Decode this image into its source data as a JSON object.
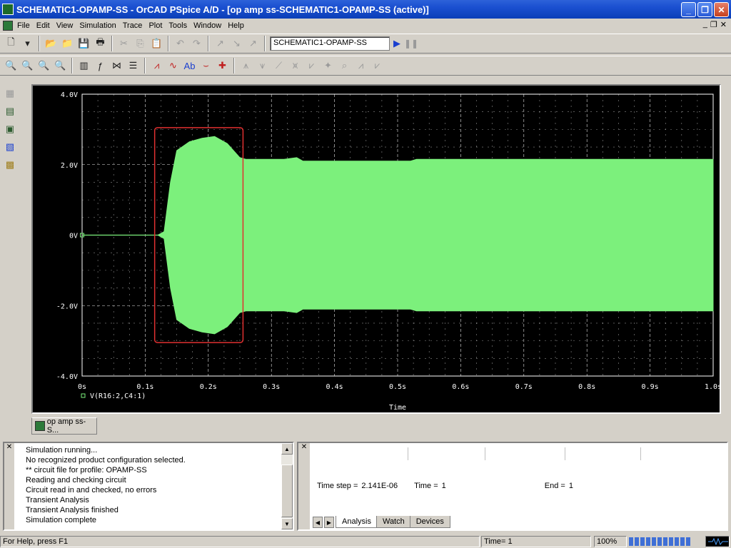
{
  "window": {
    "title": "SCHEMATIC1-OPAMP-SS - OrCAD PSpice A/D  - [op amp ss-SCHEMATIC1-OPAMP-SS (active)]",
    "minimize": "_",
    "maximize": "❐",
    "close": "✕"
  },
  "menu": {
    "items": [
      "File",
      "Edit",
      "View",
      "Simulation",
      "Trace",
      "Plot",
      "Tools",
      "Window",
      "Help"
    ],
    "mdi_minimize": "_",
    "mdi_restore": "❐",
    "mdi_close": "✕"
  },
  "toolbar": {
    "profile": "SCHEMATIC1-OPAMP-SS",
    "run": "▶",
    "pause": "❚❚"
  },
  "plot": {
    "x_label": "Time",
    "legend": "V(R16:2,C4:1)",
    "colors": {
      "background": "#000000",
      "trace": "#7cf07c",
      "grid": "#ffffff",
      "highlight": "#e03030"
    },
    "chart_data": {
      "type": "line",
      "xlabel": "Time",
      "ylabel": "",
      "xlim": [
        0,
        1.0
      ],
      "ylim": [
        -4,
        4
      ],
      "x_ticks": [
        "0s",
        "0.1s",
        "0.2s",
        "0.3s",
        "0.4s",
        "0.5s",
        "0.6s",
        "0.7s",
        "0.8s",
        "0.9s",
        "1.0s"
      ],
      "y_ticks": [
        "4.0V",
        "2.0V",
        "0V",
        "-2.0V",
        "-4.0V"
      ],
      "grid": true,
      "series": [
        {
          "name": "V(R16:2,C4:1)",
          "envelope": {
            "x": [
              0.0,
              0.12,
              0.13,
              0.14,
              0.15,
              0.17,
              0.19,
              0.21,
              0.23,
              0.25,
              0.26,
              0.32,
              0.34,
              0.35,
              0.52,
              0.53,
              1.0
            ],
            "upper": [
              0.0,
              0.0,
              0.1,
              1.5,
              2.4,
              2.65,
              2.75,
              2.8,
              2.6,
              2.2,
              2.15,
              2.15,
              2.2,
              2.1,
              2.1,
              2.15,
              2.15
            ],
            "lower": [
              0.0,
              0.0,
              -0.1,
              -1.5,
              -2.4,
              -2.65,
              -2.75,
              -2.8,
              -2.6,
              -2.2,
              -2.15,
              -2.15,
              -2.2,
              -2.1,
              -2.1,
              -2.15,
              -2.15
            ]
          }
        }
      ],
      "annotation": {
        "type": "box",
        "x": [
          0.115,
          0.255
        ],
        "y": [
          -3.05,
          3.05
        ]
      }
    }
  },
  "tabs": {
    "plot_tab": "op amp ss-S..."
  },
  "output": {
    "lines": [
      "Simulation running...",
      "No recognized product configuration selected.",
      "** circuit file for profile: OPAMP-SS",
      "Reading and checking circuit",
      "Circuit read in and checked, no errors",
      "Transient Analysis",
      "Transient Analysis finished",
      "Simulation complete"
    ]
  },
  "probe": {
    "time_step_label": "Time step =",
    "time_step_value": "2.141E-06",
    "time_label": "Time =",
    "time_value": "1",
    "end_label": "End =",
    "end_value": "1",
    "tabs": [
      "Analysis",
      "Watch",
      "Devices"
    ]
  },
  "status": {
    "help": "For Help, press F1",
    "time": "Time= 1",
    "zoom": "100%"
  }
}
